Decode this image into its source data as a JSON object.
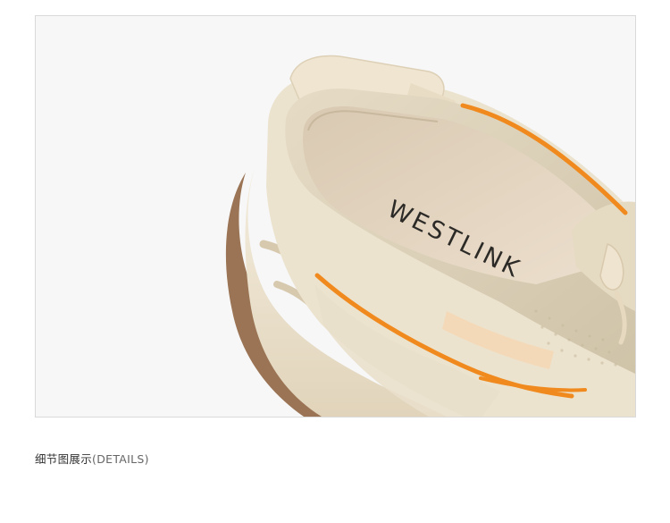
{
  "product_image": {
    "icon": "sneaker-photo",
    "insole_brand": "WESTLINK",
    "colors": {
      "background": "#f7f7f7",
      "knit_beige": "#d9cfb8",
      "insole": "#e4d7c4",
      "accent_orange": "#f08a1e",
      "sole_cream": "#efe6d2",
      "outsole_brown": "#8f6a4a"
    }
  },
  "caption": {
    "zh": "细节图展示",
    "en": "(DETAILS)"
  }
}
